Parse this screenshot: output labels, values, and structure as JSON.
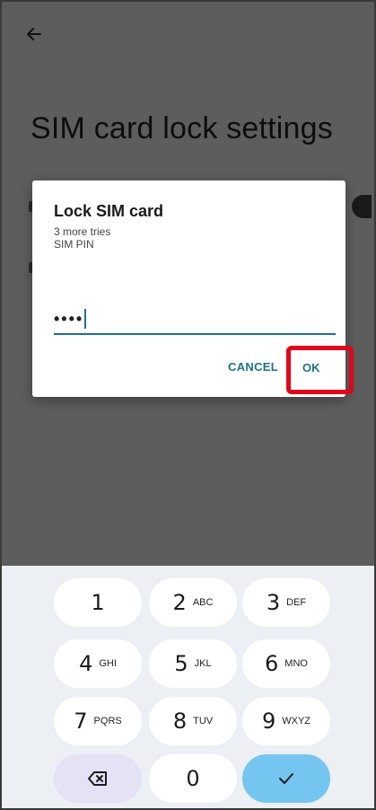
{
  "page": {
    "back_icon": "arrow-left-icon",
    "title": "SIM card lock settings"
  },
  "dialog": {
    "title": "Lock SIM card",
    "tries": "3 more tries",
    "pin_label": "SIM PIN",
    "pin_value": "••••",
    "cancel_label": "CANCEL",
    "ok_label": "OK",
    "accent_color": "#1f6f8b",
    "highlight_color": "#e2061b"
  },
  "keypad": {
    "keys": [
      {
        "num": "1",
        "letters": ""
      },
      {
        "num": "2",
        "letters": "ABC"
      },
      {
        "num": "3",
        "letters": "DEF"
      },
      {
        "num": "4",
        "letters": "GHI"
      },
      {
        "num": "5",
        "letters": "JKL"
      },
      {
        "num": "6",
        "letters": "MNO"
      },
      {
        "num": "7",
        "letters": "PQRS"
      },
      {
        "num": "8",
        "letters": "TUV"
      },
      {
        "num": "9",
        "letters": "WXYZ"
      },
      {
        "num": "0",
        "letters": ""
      }
    ],
    "delete_icon": "backspace-icon",
    "done_icon": "checkmark-icon"
  }
}
